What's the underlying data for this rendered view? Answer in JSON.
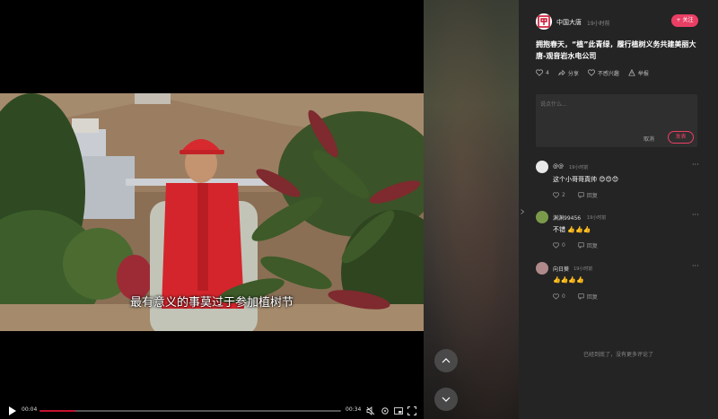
{
  "video": {
    "subtitle": "最有意义的事莫过于参加植树节",
    "current_time": "00:04",
    "duration": "00:34",
    "progress_fraction": 0.12
  },
  "author": {
    "name": "中国大唐",
    "time": "19小时前",
    "follow_label": "+ 关注"
  },
  "post": {
    "title": "拥抱春天，“植”此青绿，履行植树义务共建美丽大唐-观音岩水电公司"
  },
  "post_actions": {
    "like_count": "4",
    "share_label": "分享",
    "dislike_label": "不感兴趣",
    "report_label": "举报"
  },
  "comment_input": {
    "placeholder": "说点什么...",
    "cancel_label": "取消",
    "send_label": "发表"
  },
  "comments": [
    {
      "name": "@@",
      "time": "19小时前",
      "text": "这个小哥哥真帅 😊😊😊",
      "likes": "2",
      "reply_label": "回复",
      "avatar_color": "#e8e8e8"
    },
    {
      "name": "渊渊99456",
      "time": "19小时前",
      "text": "不错 👍👍👍",
      "likes": "0",
      "reply_label": "回复",
      "avatar_color": "#7a9a4a"
    },
    {
      "name": "向日葵",
      "time": "19小时前",
      "text": "👍👍👍👍",
      "likes": "0",
      "reply_label": "回复",
      "avatar_color": "#b08a8a"
    }
  ],
  "end_text": "已经到底了，没有更多评论了",
  "colors": {
    "accent": "#ea3f65",
    "panel_bg": "#242424",
    "progress": "#c8102e"
  }
}
